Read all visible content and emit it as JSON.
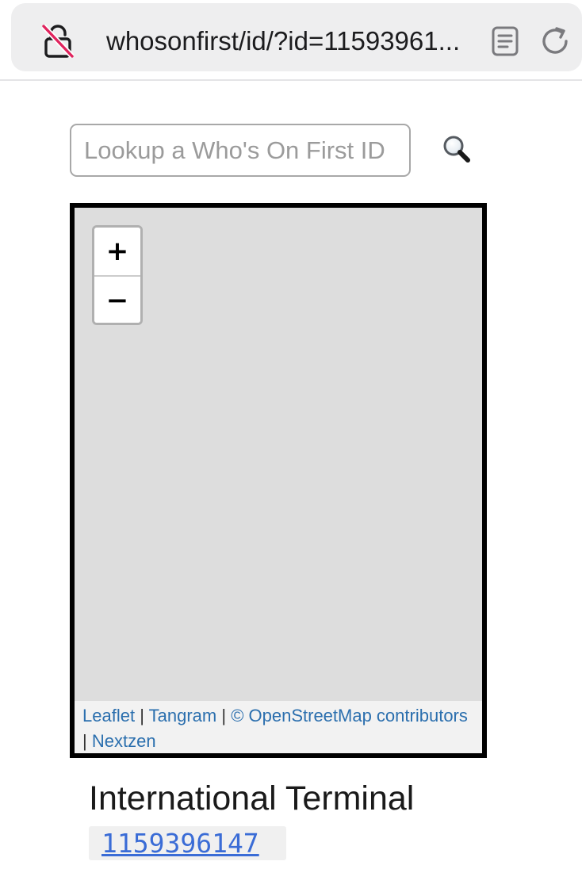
{
  "browser": {
    "url": "whosonfirst/id/?id=11593961...",
    "lock_icon": "unlocked-lock-icon",
    "reader_icon": "reader-mode-icon",
    "reload_icon": "reload-icon"
  },
  "search": {
    "placeholder": "Lookup a Who's On First ID",
    "value": "",
    "icon": "magnifier-icon"
  },
  "map": {
    "zoom_in_label": "+",
    "zoom_out_label": "−",
    "attribution": {
      "leaflet": "Leaflet",
      "tangram": "Tangram",
      "osm": "© OpenStreetMap contributors",
      "nextzen": "Nextzen",
      "separator": "|"
    },
    "background_color": "#dddddd",
    "border_color": "#000000"
  },
  "place": {
    "name": "International Terminal",
    "id": "1159396147"
  },
  "colors": {
    "link": "#2b6fae",
    "id_link": "#3a6cd6",
    "disabled_lock_slash": "#e0245e"
  }
}
